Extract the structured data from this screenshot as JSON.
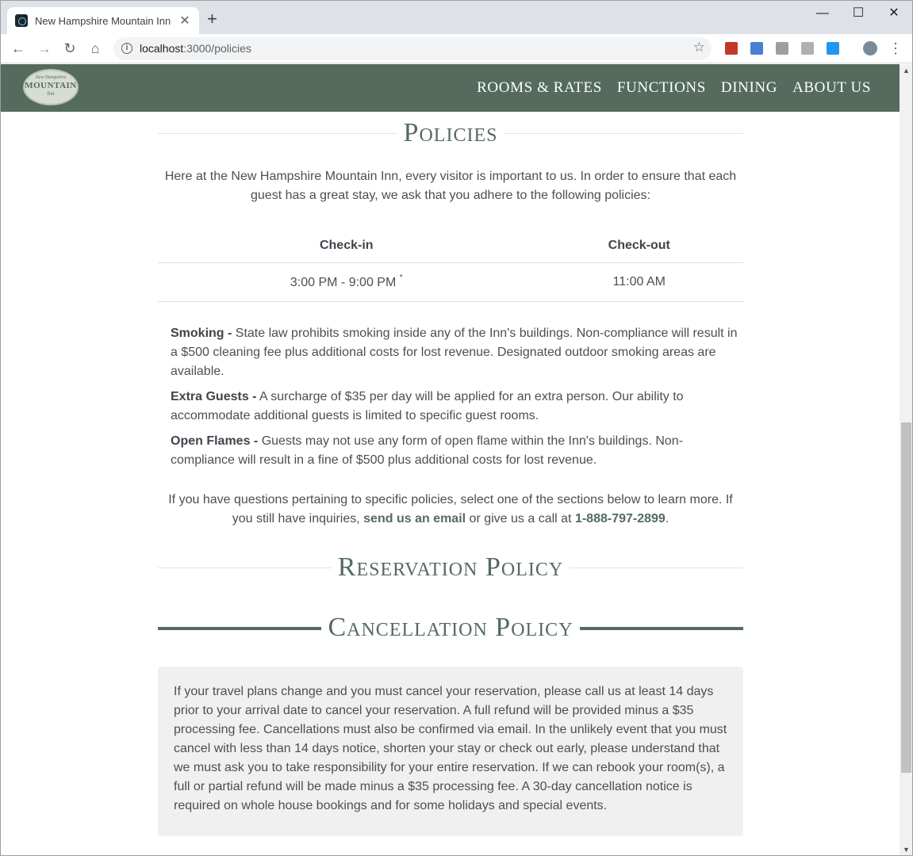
{
  "browser": {
    "tab_title": "New Hampshire Mountain Inn",
    "tab_close": "✕",
    "new_tab": "+",
    "url_host": "localhost",
    "url_path": ":3000/policies",
    "minimize": "—",
    "maximize": "☐",
    "close": "✕"
  },
  "site": {
    "logo": {
      "top": "New Hampshire",
      "main": "MOUNTAIN",
      "bottom": "Inn"
    },
    "nav": [
      "ROOMS & RATES",
      "FUNCTIONS",
      "DINING",
      "ABOUT US"
    ]
  },
  "policies": {
    "heading": "Policies",
    "intro": "Here at the New Hampshire Mountain Inn, every visitor is important to us. In order to ensure that each guest has a great stay, we ask that you adhere to the following policies:",
    "hours": {
      "checkin_header": "Check-in",
      "checkout_header": "Check-out",
      "checkin_value": "3:00 PM - 9:00 PM",
      "checkin_note_mark": "*",
      "checkout_value": "11:00 AM"
    },
    "items": [
      {
        "label": "Smoking -",
        "text": " State law prohibits smoking inside any of the Inn's buildings. Non-compliance will result in a $500 cleaning fee plus additional costs for lost revenue. Designated outdoor smoking areas are available."
      },
      {
        "label": "Extra Guests -",
        "text": " A surcharge of $35 per day will be applied for an extra person. Our ability to accommodate additional guests is limited to specific guest rooms."
      },
      {
        "label": "Open Flames -",
        "text": " Guests may not use any form of open flame within the Inn's buildings. Non-compliance will result in a fine of $500 plus additional costs for lost revenue."
      }
    ],
    "contact": {
      "before": "If you have questions pertaining to specific policies, select one of the sections below to learn more. If you still have inquiries, ",
      "email_link": "send us an email",
      "middle": " or give us a call at ",
      "phone": "1-888-797-2899",
      "after": "."
    }
  },
  "reservation": {
    "heading": "Reservation Policy"
  },
  "cancellation": {
    "heading": "Cancellation Policy",
    "text": "If your travel plans change and you must cancel your reservation, please call us at least 14 days prior to your arrival date to cancel your reservation. A full refund will be provided minus a $35 processing fee. Cancellations must also be confirmed via email. In the unlikely event that you must cancel with less than 14 days notice, shorten your stay or check out early, please understand that we must ask you to take responsibility for your entire reservation. If we can rebook your room(s), a full or partial refund will be made minus a $35 processing fee. A 30-day cancellation notice is required on whole house bookings and for some holidays and special events."
  }
}
